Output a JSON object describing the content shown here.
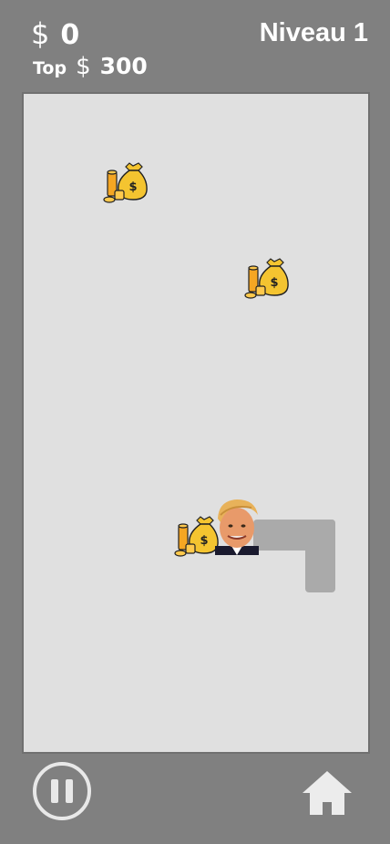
{
  "hud": {
    "currency_symbol": "$",
    "score": "0",
    "top_label": "Top",
    "top_score": "300",
    "level": "Niveau 1"
  },
  "icons": {
    "money_bag": "money-bag-icon",
    "pause": "pause-icon",
    "home": "home-icon",
    "player": "player-face"
  },
  "colors": {
    "background": "#808080",
    "board": "#e0e0e0",
    "snake_body": "#aaaaaa",
    "bag": "#f4c430",
    "coin": "#f5a623"
  }
}
